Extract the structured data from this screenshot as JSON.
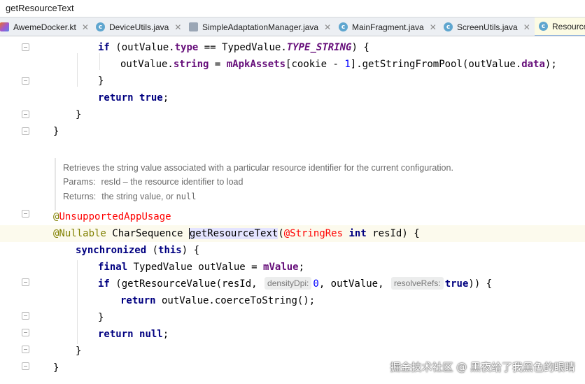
{
  "window": {
    "title": "getResourceText"
  },
  "tabs": [
    {
      "label": "AwemeDocker.kt",
      "icon": "kotlin-file-icon",
      "closable": true
    },
    {
      "label": "DeviceUtils.java",
      "icon": "java-class-icon",
      "closable": true
    },
    {
      "label": "SimpleAdaptationManager.java",
      "icon": "java-library-class-icon",
      "closable": true
    },
    {
      "label": "MainFragment.java",
      "icon": "java-class-icon",
      "closable": true
    },
    {
      "label": "ScreenUtils.java",
      "icon": "java-class-icon",
      "closable": true
    },
    {
      "label": "Resource",
      "icon": "java-class-icon",
      "active": true
    }
  ],
  "code": {
    "l1": {
      "kw_if": "if",
      "p1": " (outValue",
      "dot": ".",
      "type": "type",
      "eq": " == TypedValue.",
      "const": "TYPE_STRING",
      "p2": ") {"
    },
    "l2": {
      "a": "outValue.",
      "f1": "string",
      "b": " = ",
      "f2": "mApkAssets",
      "c": "[cookie - ",
      "n": "1",
      "d": "].getStringFromPool(outValue.",
      "f3": "data",
      "e": ");"
    },
    "l3": "}",
    "l4": {
      "kw": "return",
      "sp": " ",
      "val": "true",
      "semi": ";"
    },
    "l5": "}",
    "l6": "}",
    "l7": {
      "at": "@",
      "name": "UnsupportedAppUsage"
    },
    "l8": {
      "ann": "@Nullable",
      "t": " CharSequence ",
      "m": "getResourceText",
      "p": "(",
      "ann2": "@StringRes",
      "sp": " ",
      "kw": "int",
      "rest": " resId) {"
    },
    "l9": {
      "kw": "synchronized",
      "a": " (",
      "kw2": "this",
      "b": ") {"
    },
    "l10": {
      "kw": "final",
      "a": " TypedValue outValue = ",
      "f": "mValue",
      "b": ";"
    },
    "l11": {
      "kw": "if",
      "a": " (getResourceValue(resId, ",
      "h1": "densityDpi:",
      "n": "0",
      "b": ", outValue, ",
      "h2": "resolveRefs:",
      "kw2": "true",
      "c": ")) {"
    },
    "l12": {
      "kw": "return",
      "a": " outValue.coerceToString();"
    },
    "l13": "}",
    "l14": {
      "kw": "return",
      "sp": " ",
      "val": "null",
      "semi": ";"
    },
    "l15": "}",
    "l16": "}"
  },
  "doc": {
    "summary": "Retrieves the string value associated with a particular resource identifier for the current configuration.",
    "params_label": "Params:",
    "params_text": "resId – the resource identifier to load",
    "returns_label": "Returns:",
    "returns_text": "the string value, or ",
    "returns_code": "null"
  },
  "watermark": "掘金技术社区 @ 黑夜给了我黑色的眼睛",
  "colors": {
    "keyword": "#000080",
    "field": "#660e7a",
    "number": "#0000ff",
    "annotation": "#808000",
    "unresolved_annotation": "#ff0000",
    "current_line": "#fcfaed",
    "active_tab": "#fcfbe4"
  }
}
